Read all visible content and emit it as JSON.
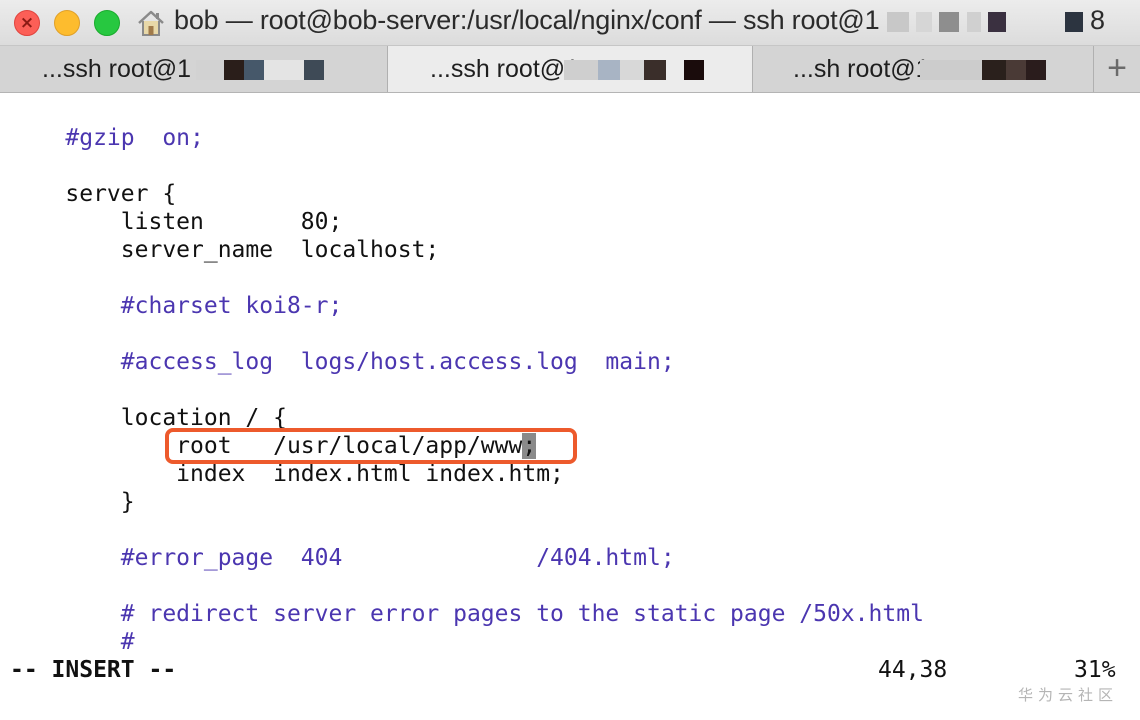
{
  "window": {
    "title": "bob — root@bob-server:/usr/local/nginx/conf — ssh root@1",
    "title_tail": "8",
    "close_glyph": "×",
    "home_icon": "house-icon"
  },
  "tabs": [
    {
      "label": "...ssh root@1",
      "active": false
    },
    {
      "label": "...ssh root@1",
      "active": true
    },
    {
      "label": "...sh root@1",
      "active": false
    }
  ],
  "new_tab_label": "+",
  "editor": {
    "lines": [
      {
        "text": "    #gzip  on;",
        "comment": true
      },
      {
        "text": "",
        "comment": false
      },
      {
        "text": "    server {",
        "comment": false
      },
      {
        "text": "        listen       80;",
        "comment": false
      },
      {
        "text": "        server_name  localhost;",
        "comment": false
      },
      {
        "text": "",
        "comment": false
      },
      {
        "text": "        #charset koi8-r;",
        "comment": true
      },
      {
        "text": "",
        "comment": false
      },
      {
        "text": "        #access_log  logs/host.access.log  main;",
        "comment": true
      },
      {
        "text": "",
        "comment": false
      },
      {
        "text": "        location / {",
        "comment": false
      },
      {
        "text": "            root   /usr/local/app/www",
        "comment": false,
        "cursor": ";"
      },
      {
        "text": "            index  index.html index.htm;",
        "comment": false
      },
      {
        "text": "        }",
        "comment": false
      },
      {
        "text": "",
        "comment": false
      },
      {
        "text": "        #error_page  404              /404.html;",
        "comment": true
      },
      {
        "text": "",
        "comment": false
      },
      {
        "text": "        # redirect server error pages to the static page /50x.html",
        "comment": true
      },
      {
        "text": "        #",
        "comment": true
      }
    ],
    "mode": "-- INSERT --",
    "position": "44,38",
    "percent": "31%"
  },
  "watermark": "华为云社区",
  "colors": {
    "comment": "#4b36b0",
    "highlight": "#ed5a2c",
    "cursor": "#8a8a8a"
  }
}
